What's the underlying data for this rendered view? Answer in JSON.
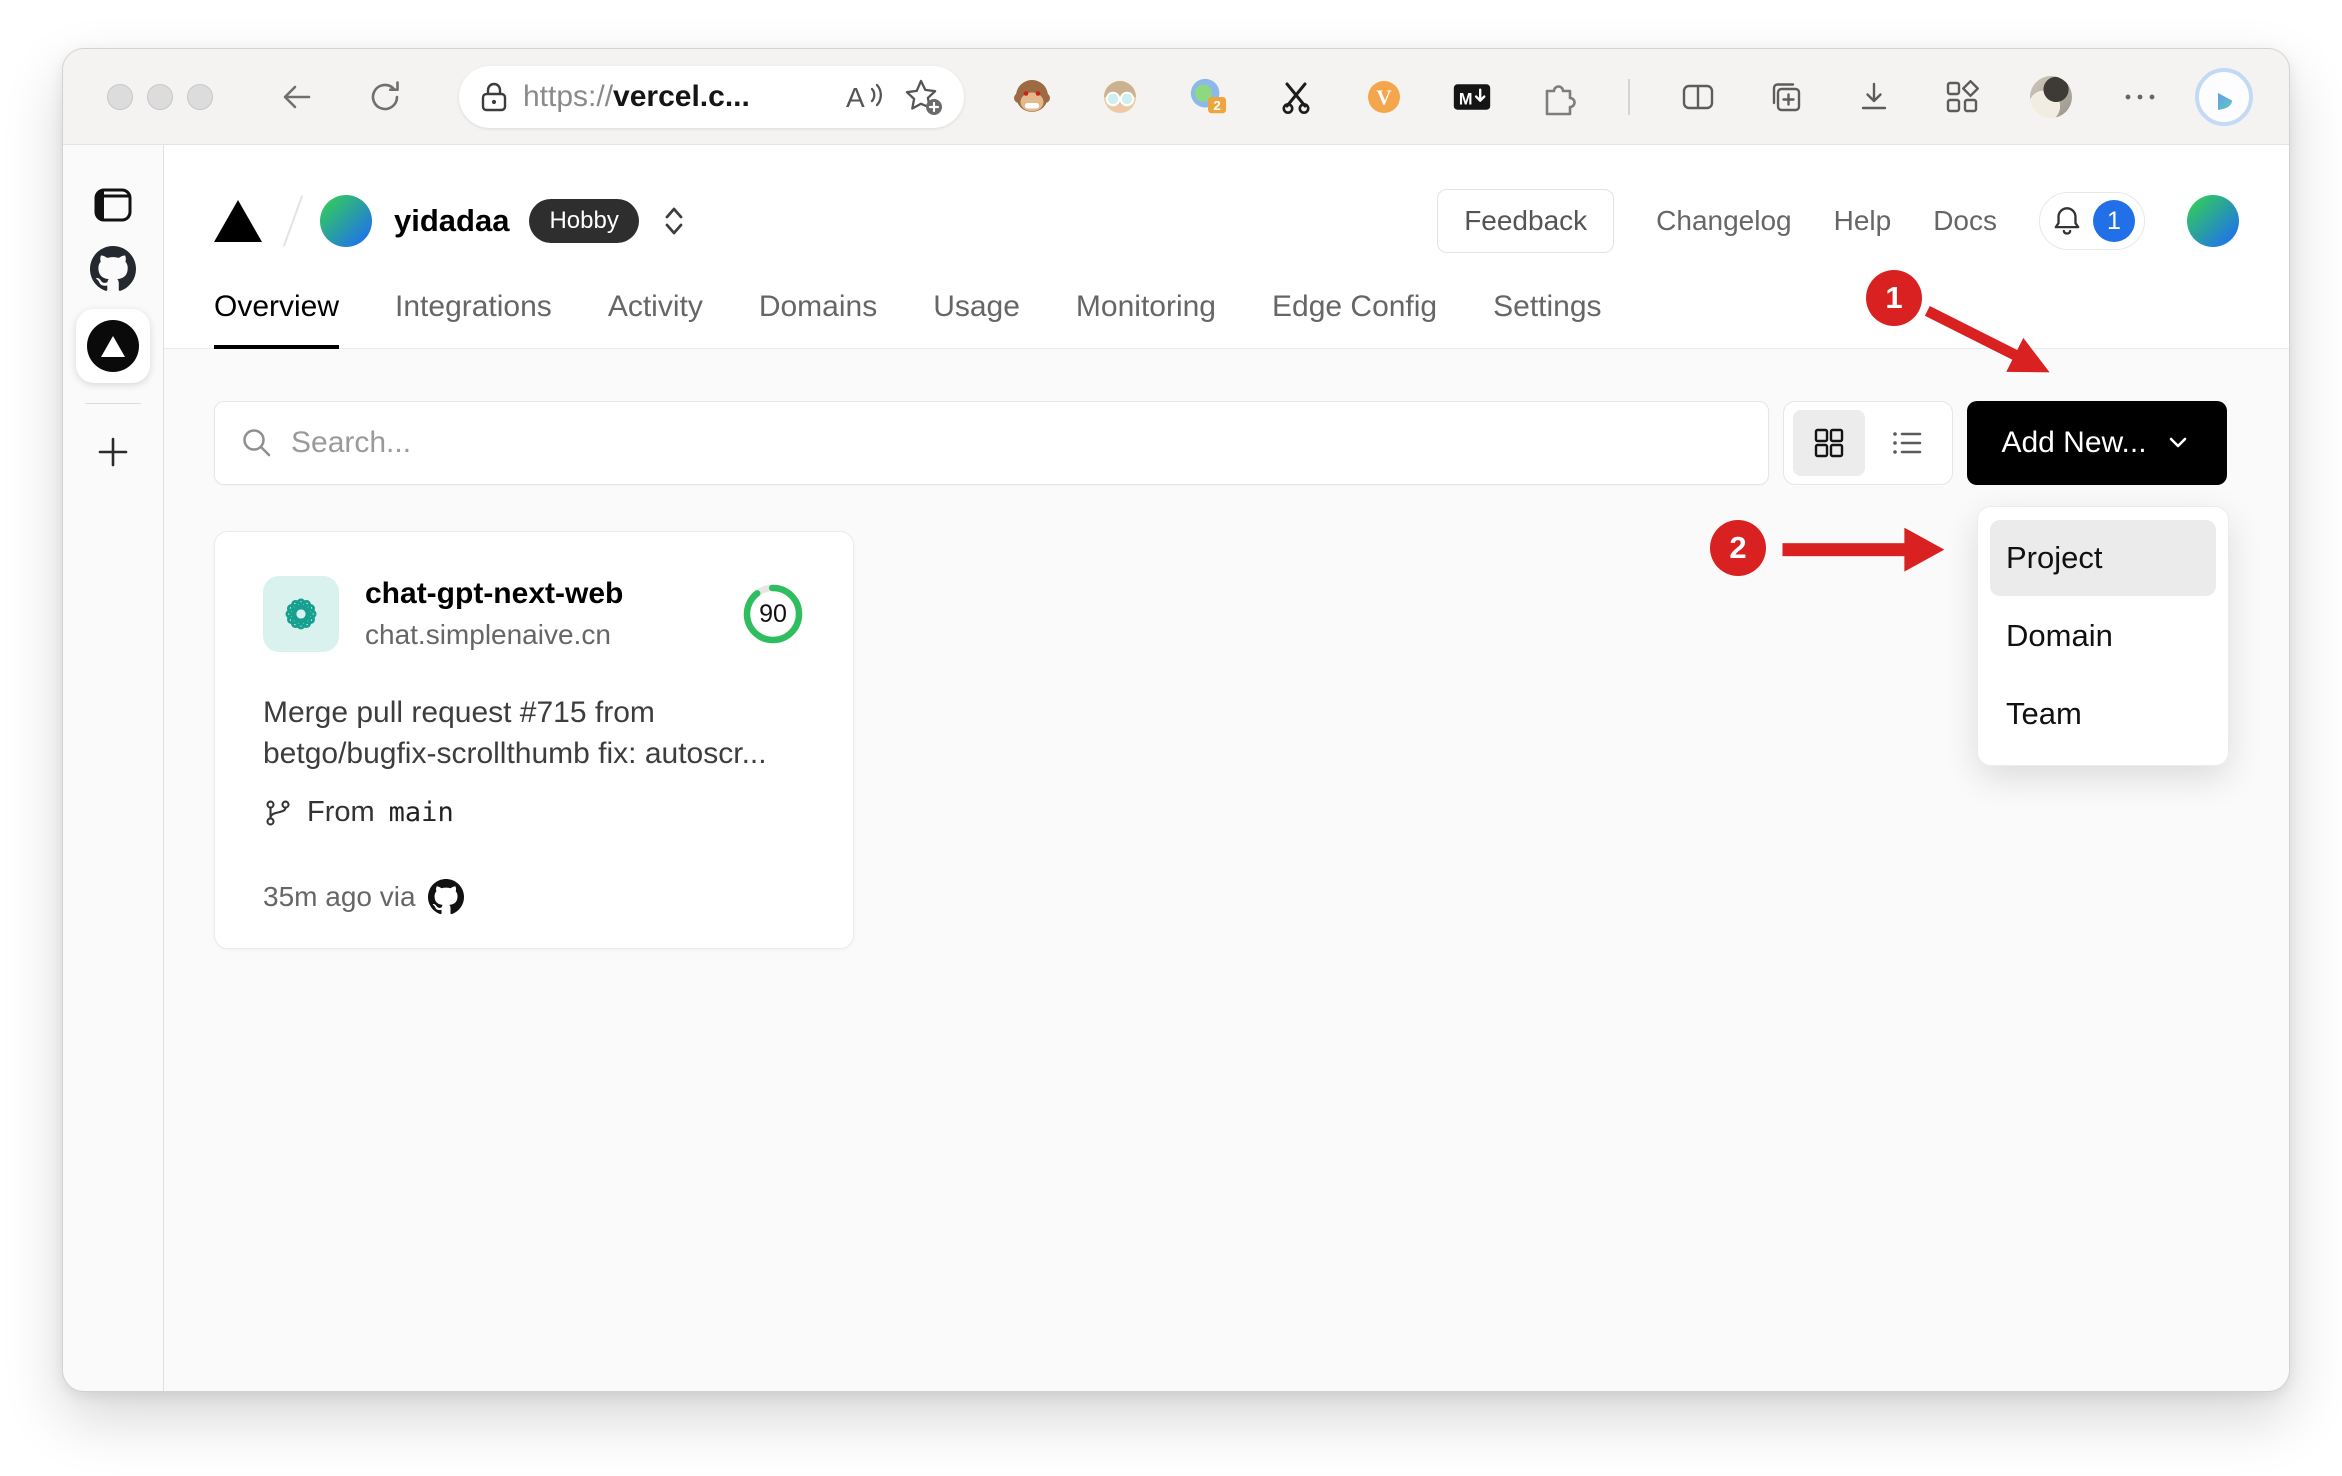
{
  "browser": {
    "url": {
      "scheme": "https://",
      "host": "vercel.c..."
    },
    "extensions": {
      "tab_count_badge": "2",
      "video_icon_letter": "V",
      "markdown_icon_letter": "M"
    }
  },
  "header": {
    "team_name": "yidadaa",
    "plan_badge": "Hobby",
    "feedback_label": "Feedback",
    "links": {
      "changelog": "Changelog",
      "help": "Help",
      "docs": "Docs"
    },
    "notification_count": "1"
  },
  "tabs": [
    {
      "label": "Overview",
      "active": true
    },
    {
      "label": "Integrations"
    },
    {
      "label": "Activity"
    },
    {
      "label": "Domains"
    },
    {
      "label": "Usage"
    },
    {
      "label": "Monitoring"
    },
    {
      "label": "Edge Config"
    },
    {
      "label": "Settings"
    }
  ],
  "toolbar": {
    "search_placeholder": "Search...",
    "add_new_label": "Add New..."
  },
  "dropdown": {
    "items": [
      {
        "label": "Project",
        "highlighted": true
      },
      {
        "label": "Domain"
      },
      {
        "label": "Team"
      }
    ]
  },
  "project_card": {
    "name": "chat-gpt-next-web",
    "domain": "chat.simplenaive.cn",
    "score": "90",
    "desc_line1": "Merge pull request #715 from",
    "desc_line2": "betgo/bugfix-scrollthumb fix: autoscr...",
    "branch_prefix": "From",
    "branch_name": "main",
    "updated": "35m ago via"
  },
  "annotations": {
    "step1": "1",
    "step2": "2"
  },
  "colors": {
    "accent_red": "#d92121",
    "notif_blue": "#2170e8",
    "score_green": "#2fbe5f",
    "openai_teal": "#17a08f",
    "add_new_bg": "#000000"
  }
}
